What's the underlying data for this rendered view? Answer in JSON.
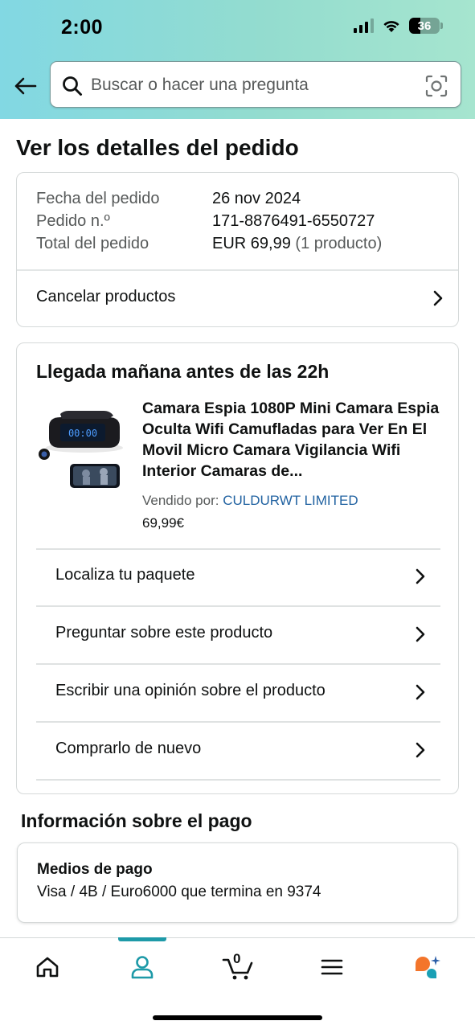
{
  "status_bar": {
    "time": "2:00",
    "battery": "36",
    "battery_fraction": 0.36
  },
  "search": {
    "placeholder": "Buscar o hacer una pregunta"
  },
  "page_title": "Ver los detalles del pedido",
  "order_summary": {
    "date_label": "Fecha del pedido",
    "date_value": "26 nov 2024",
    "number_label": "Pedido n.º",
    "number_value": "171-8876491-6550727",
    "total_label": "Total del pedido",
    "total_value": "EUR 69,99",
    "total_count": "(1 producto)",
    "cancel_label": "Cancelar productos"
  },
  "delivery": {
    "title": "Llegada mañana antes de las 22h",
    "product_title": "Camara Espia 1080P Mini Camara Espia Oculta Wifi Camufladas para Ver En El Movil Micro Camara Vigilancia Wifi Interior Camaras de...",
    "sold_by_label": "Vendido por:",
    "seller": "CULDURWT LIMITED",
    "price": "69,99€",
    "clock_display": "00:00",
    "actions": [
      {
        "label": "Localiza tu paquete"
      },
      {
        "label": "Preguntar sobre este producto"
      },
      {
        "label": "Escribir una opinión sobre el producto"
      },
      {
        "label": "Comprarlo de nuevo"
      }
    ]
  },
  "payment": {
    "section_title": "Información sobre el pago",
    "method_title": "Medios de pago",
    "method_value": "Visa / 4B / Euro6000  que termina en 9374"
  },
  "tab_bar": {
    "cart_count": "0",
    "tabs": [
      {
        "name": "home-icon",
        "active": false
      },
      {
        "name": "account-icon",
        "active": true
      },
      {
        "name": "cart-icon",
        "active": false
      },
      {
        "name": "menu-icon",
        "active": false
      },
      {
        "name": "assistant-icon",
        "active": false
      }
    ]
  },
  "colors": {
    "accent": "#1e9aa8",
    "link": "#2162a1",
    "assistant_orange": "#f3752b",
    "assistant_teal": "#1aa0b5"
  }
}
